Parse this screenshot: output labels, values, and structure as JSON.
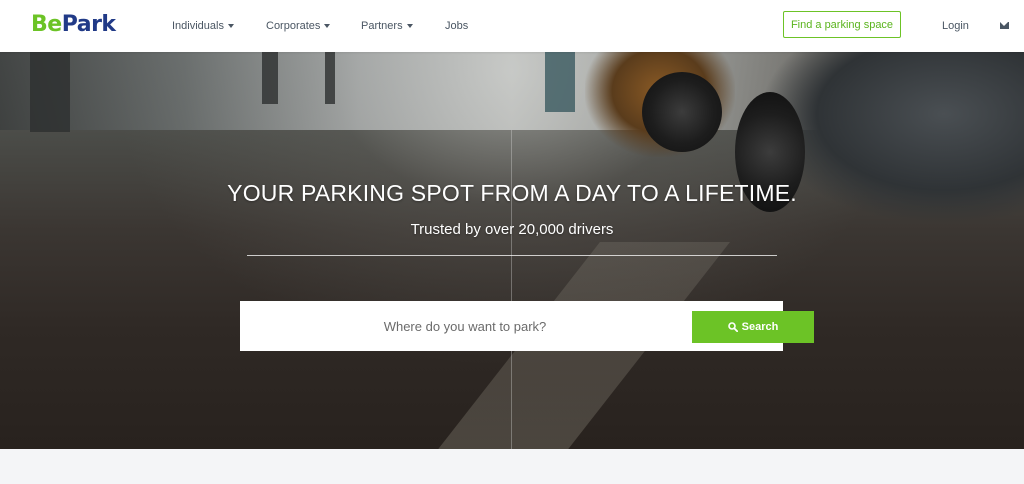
{
  "brand": {
    "logo_be": "Be",
    "logo_park": "Park",
    "colors": {
      "green": "#6cc326",
      "navy": "#213a87"
    }
  },
  "nav": {
    "items": [
      {
        "label": "Individuals",
        "has_dropdown": true
      },
      {
        "label": "Corporates",
        "has_dropdown": true
      },
      {
        "label": "Partners",
        "has_dropdown": true
      },
      {
        "label": "Jobs",
        "has_dropdown": false
      }
    ],
    "cta_label": "Find a parking space",
    "login_label": "Login",
    "mail_icon": "envelope-icon"
  },
  "hero": {
    "headline": "YOUR PARKING SPOT FROM A DAY TO A LIFETIME.",
    "subline": "Trusted by over 20,000 drivers",
    "search": {
      "placeholder": "Where do you want to park?",
      "button_label": "Search",
      "button_icon": "search-icon"
    }
  }
}
